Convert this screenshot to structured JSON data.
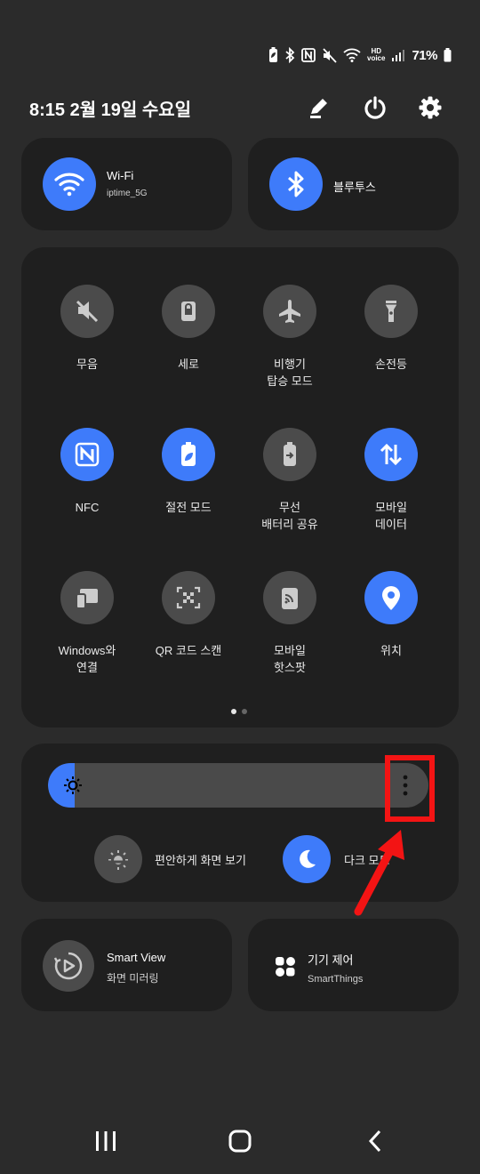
{
  "status_bar": {
    "icons": [
      "battery-saver-icon",
      "bluetooth-icon",
      "nfc-icon",
      "mute-icon",
      "wifi-icon",
      "hd-voice-icon",
      "signal-icon"
    ],
    "hd_top": "HD",
    "hd_bottom": "voice",
    "battery": "71%"
  },
  "header": {
    "datetime": "8:15  2월 19일 수요일",
    "buttons": [
      "edit-icon",
      "power-icon",
      "settings-icon"
    ]
  },
  "wifi_tile": {
    "title": "Wi-Fi",
    "subtitle": "iptime_5G",
    "state": "on"
  },
  "bluetooth_tile": {
    "title": "블루투스",
    "state": "on"
  },
  "quick_settings": [
    {
      "label": "무음",
      "icon": "mute-icon",
      "state": "off"
    },
    {
      "label": "세로",
      "icon": "portrait-lock-icon",
      "state": "off"
    },
    {
      "label": "비행기\n탑승 모드",
      "icon": "airplane-icon",
      "state": "off"
    },
    {
      "label": "손전등",
      "icon": "flashlight-icon",
      "state": "off"
    },
    {
      "label": "NFC",
      "icon": "nfc-icon",
      "state": "on"
    },
    {
      "label": "절전 모드",
      "icon": "power-saving-icon",
      "state": "on"
    },
    {
      "label": "무선\n배터리 공유",
      "icon": "wireless-powershare-icon",
      "state": "off"
    },
    {
      "label": "모바일\n데이터",
      "icon": "mobile-data-icon",
      "state": "on"
    },
    {
      "label": "Windows와\n연결",
      "icon": "link-to-windows-icon",
      "state": "off"
    },
    {
      "label": "QR 코드 스캔",
      "icon": "qr-scan-icon",
      "state": "off"
    },
    {
      "label": "모바일\n핫스팟",
      "icon": "hotspot-icon",
      "state": "off"
    },
    {
      "label": "위치",
      "icon": "location-icon",
      "state": "on"
    }
  ],
  "page_indicator": {
    "pages": 2,
    "current": 1
  },
  "brightness": {
    "level": 0.07
  },
  "eye_comfort": {
    "label": "편안하게 화면 보기",
    "state": "off"
  },
  "dark_mode": {
    "label": "다크 모드",
    "state": "on"
  },
  "smart_view": {
    "title": "Smart View",
    "subtitle": "화면 미러링"
  },
  "device_control": {
    "title": "기기 제어",
    "subtitle": "SmartThings"
  },
  "navigation": [
    "recent-apps-icon",
    "home-icon",
    "back-icon"
  ],
  "colors": {
    "accent": "#3e7bfa",
    "annotation": "#f31414",
    "background": "#2b2b2b",
    "card": "#1f1f1f"
  }
}
